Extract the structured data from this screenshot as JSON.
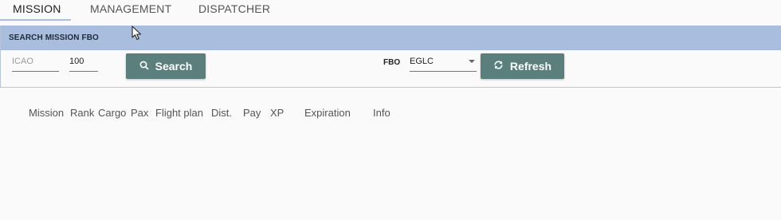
{
  "tabs": [
    {
      "label": "MISSION",
      "active": true
    },
    {
      "label": "MANAGEMENT",
      "active": false
    },
    {
      "label": "DISPATCHER",
      "active": false
    }
  ],
  "search_panel": {
    "title": "SEARCH MISSION FBO",
    "icao_placeholder": "ICAO",
    "radius_value": "100",
    "search_button": "Search",
    "fbo_label": "FBO",
    "fbo_selected": "EGLC",
    "refresh_button": "Refresh"
  },
  "table": {
    "columns": [
      "Mission",
      "Rank",
      "Cargo",
      "Pax",
      "Flight plan",
      "Dist.",
      "Pay",
      "XP",
      "Expiration",
      "Info"
    ]
  },
  "colors": {
    "accent": "#a9bede",
    "button": "#5b7f7c",
    "background": "#fafafa"
  }
}
